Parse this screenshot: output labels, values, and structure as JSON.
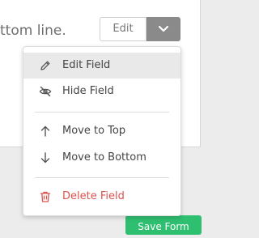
{
  "field": {
    "text_fragment": "ttom line."
  },
  "toolbar": {
    "edit_label": "Edit",
    "toggle_icon": "chevron-down-icon"
  },
  "menu": {
    "items": [
      {
        "label": "Edit Field",
        "icon": "pencil-icon",
        "active": true
      },
      {
        "label": "Hide Field",
        "icon": "eye-slash-icon"
      },
      {
        "label": "Move to Top",
        "icon": "arrow-up-icon"
      },
      {
        "label": "Move to Bottom",
        "icon": "arrow-down-icon"
      },
      {
        "label": "Delete Field",
        "icon": "trash-icon",
        "danger": true
      }
    ]
  },
  "footer": {
    "save_label": "Save Form"
  },
  "colors": {
    "accent_green": "#2fbf71",
    "danger_red": "#d9534f",
    "active_bg": "#e9e9e9"
  }
}
